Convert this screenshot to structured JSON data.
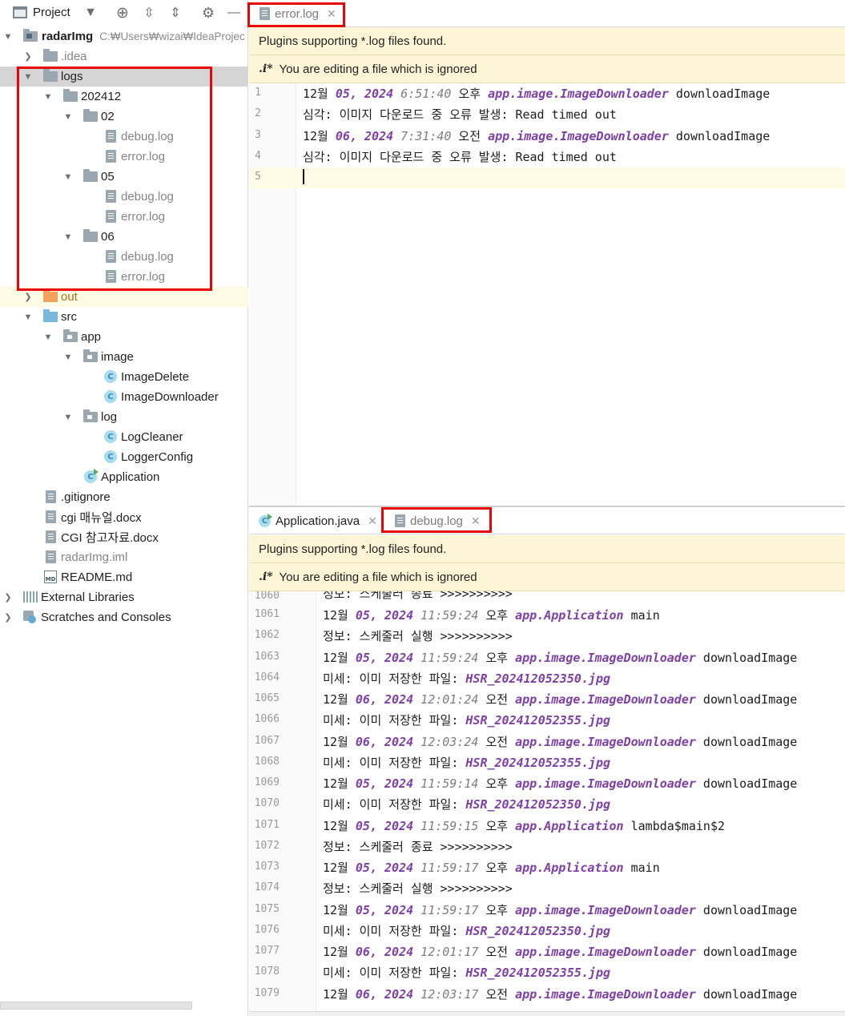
{
  "project_toolbar": {
    "title": "Project",
    "icons": [
      "window-icon",
      "chevron-down-icon",
      "locate-icon",
      "expand-all-icon",
      "collapse-all-icon",
      "gear-icon",
      "minimize-icon"
    ]
  },
  "tree": {
    "root_name": "radarImg",
    "root_path": "C:₩Users₩wizai₩IdeaProjec",
    "idea": ".idea",
    "logs": "logs",
    "f202412": "202412",
    "f02": "02",
    "f05": "05",
    "f06": "06",
    "debug_log": "debug.log",
    "error_log": "error.log",
    "out": "out",
    "src": "src",
    "app": "app",
    "image": "image",
    "image_delete": "ImageDelete",
    "image_downloader": "ImageDownloader",
    "log": "log",
    "log_cleaner": "LogCleaner",
    "logger_config": "LoggerConfig",
    "application": "Application",
    "gitignore": ".gitignore",
    "cgi_manual": "cgi 매뉴얼.docx",
    "cgi_ref": "CGI 참고자료.docx",
    "iml": "radarImg.iml",
    "readme": "README.md",
    "ext_libs": "External Libraries",
    "scratches": "Scratches and Consoles",
    "class_glyph": "C",
    "md_glyph": "MD"
  },
  "top_editor": {
    "tab_label": "error.log",
    "close_glyph": "✕",
    "banner1": "Plugins supporting *.log files found.",
    "banner2_icon": ".i*",
    "banner2": "You are editing a file which is ignored",
    "lines": [
      {
        "n": "1",
        "a": "12월 ",
        "b": "05, 2024",
        "c": " 6:51:40",
        "d": " 오후 ",
        "e": "app.image.ImageDownloader",
        "f": " downloadImage"
      },
      {
        "n": "2",
        "a": "심각: 이미지 다운로드 중 오류 발생: Read timed out",
        "b": "",
        "c": "",
        "d": "",
        "e": "",
        "f": ""
      },
      {
        "n": "3",
        "a": "12월 ",
        "b": "06, 2024",
        "c": " 7:31:40",
        "d": " 오전 ",
        "e": "app.image.ImageDownloader",
        "f": " downloadImage"
      },
      {
        "n": "4",
        "a": "심각: 이미지 다운로드 중 오류 발생: Read timed out",
        "b": "",
        "c": "",
        "d": "",
        "e": "",
        "f": ""
      },
      {
        "n": "5",
        "a": "",
        "b": "",
        "c": "",
        "d": "",
        "e": "",
        "f": ""
      }
    ]
  },
  "bottom_editor": {
    "tab1_label": "Application.java",
    "tab2_label": "debug.log",
    "close_glyph": "✕",
    "banner1": "Plugins supporting *.log files found.",
    "banner2_icon": ".i*",
    "banner2": "You are editing a file which is ignored",
    "partial_top": {
      "n": "1060",
      "t": "정보: 스케줄러 종료 >>>>>>>>>>"
    },
    "lines": [
      {
        "n": "1061",
        "a": "12월 ",
        "b": "05, 2024",
        "c": " 11:59:24",
        "d": " 오후 ",
        "e": "app.Application",
        "f": " main"
      },
      {
        "n": "1062",
        "a": "정보: 스케줄러 실행 >>>>>>>>>>",
        "b": "",
        "c": "",
        "d": "",
        "e": "",
        "f": ""
      },
      {
        "n": "1063",
        "a": "12월 ",
        "b": "05, 2024",
        "c": " 11:59:24",
        "d": " 오후 ",
        "e": "app.image.ImageDownloader",
        "f": " downloadImage"
      },
      {
        "n": "1064",
        "a": "미세: 이미 저장한 파일: ",
        "b": "",
        "c": "",
        "d": "",
        "e": "HSR_202412052350.jpg",
        "f": ""
      },
      {
        "n": "1065",
        "a": "12월 ",
        "b": "06, 2024",
        "c": " 12:01:24",
        "d": " 오전 ",
        "e": "app.image.ImageDownloader",
        "f": " downloadImage"
      },
      {
        "n": "1066",
        "a": "미세: 이미 저장한 파일: ",
        "b": "",
        "c": "",
        "d": "",
        "e": "HSR_202412052355.jpg",
        "f": ""
      },
      {
        "n": "1067",
        "a": "12월 ",
        "b": "06, 2024",
        "c": " 12:03:24",
        "d": " 오전 ",
        "e": "app.image.ImageDownloader",
        "f": " downloadImage"
      },
      {
        "n": "1068",
        "a": "미세: 이미 저장한 파일: ",
        "b": "",
        "c": "",
        "d": "",
        "e": "HSR_202412052355.jpg",
        "f": ""
      },
      {
        "n": "1069",
        "a": "12월 ",
        "b": "05, 2024",
        "c": " 11:59:14",
        "d": " 오후 ",
        "e": "app.image.ImageDownloader",
        "f": " downloadImage"
      },
      {
        "n": "1070",
        "a": "미세: 이미 저장한 파일: ",
        "b": "",
        "c": "",
        "d": "",
        "e": "HSR_202412052350.jpg",
        "f": ""
      },
      {
        "n": "1071",
        "a": "12월 ",
        "b": "05, 2024",
        "c": " 11:59:15",
        "d": " 오후 ",
        "e": "app.Application",
        "f": " lambda$main$2"
      },
      {
        "n": "1072",
        "a": "정보: 스케줄러 종료 >>>>>>>>>>",
        "b": "",
        "c": "",
        "d": "",
        "e": "",
        "f": ""
      },
      {
        "n": "1073",
        "a": "12월 ",
        "b": "05, 2024",
        "c": " 11:59:17",
        "d": " 오후 ",
        "e": "app.Application",
        "f": " main"
      },
      {
        "n": "1074",
        "a": "정보: 스케줄러 실행 >>>>>>>>>>",
        "b": "",
        "c": "",
        "d": "",
        "e": "",
        "f": ""
      },
      {
        "n": "1075",
        "a": "12월 ",
        "b": "05, 2024",
        "c": " 11:59:17",
        "d": " 오후 ",
        "e": "app.image.ImageDownloader",
        "f": " downloadImage"
      },
      {
        "n": "1076",
        "a": "미세: 이미 저장한 파일: ",
        "b": "",
        "c": "",
        "d": "",
        "e": "HSR_202412052350.jpg",
        "f": ""
      },
      {
        "n": "1077",
        "a": "12월 ",
        "b": "06, 2024",
        "c": " 12:01:17",
        "d": " 오전 ",
        "e": "app.image.ImageDownloader",
        "f": " downloadImage"
      },
      {
        "n": "1078",
        "a": "미세: 이미 저장한 파일: ",
        "b": "",
        "c": "",
        "d": "",
        "e": "HSR_202412052355.jpg",
        "f": ""
      },
      {
        "n": "1079",
        "a": "12월 ",
        "b": "06, 2024",
        "c": " 12:03:17",
        "d": " 오전 ",
        "e": "app.image.ImageDownloader",
        "f": " downloadImage"
      }
    ]
  },
  "colors": {
    "highlight_box": "#e8050a",
    "banner_bg": "#fcf6d6",
    "keyword_purple": "#7e3fa8",
    "selection_gray": "#d5d5d5"
  }
}
